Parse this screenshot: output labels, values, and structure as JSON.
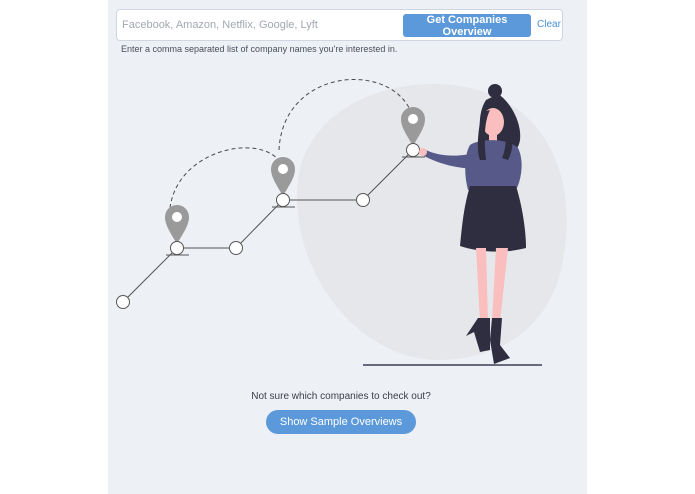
{
  "search": {
    "placeholder": "Facebook, Amazon, Netflix, Google, Lyft",
    "value": "",
    "submit_label": "Get Companies Overview",
    "clear_label": "Clear",
    "help_text": "Enter a comma separated list of company names you're interested in."
  },
  "samples": {
    "prompt": "Not sure which companies to check out?",
    "button_label": "Show Sample Overviews"
  },
  "colors": {
    "accent": "#5b99da",
    "panel_background": "#edf0f5",
    "pin": "#999999",
    "figure_top": "#575a89",
    "figure_dark": "#2f2e41",
    "skin": "#fbbebe"
  },
  "illustration": {
    "icons": [
      "map-pin-icon",
      "route-node-icon",
      "woman-figure-icon"
    ]
  }
}
